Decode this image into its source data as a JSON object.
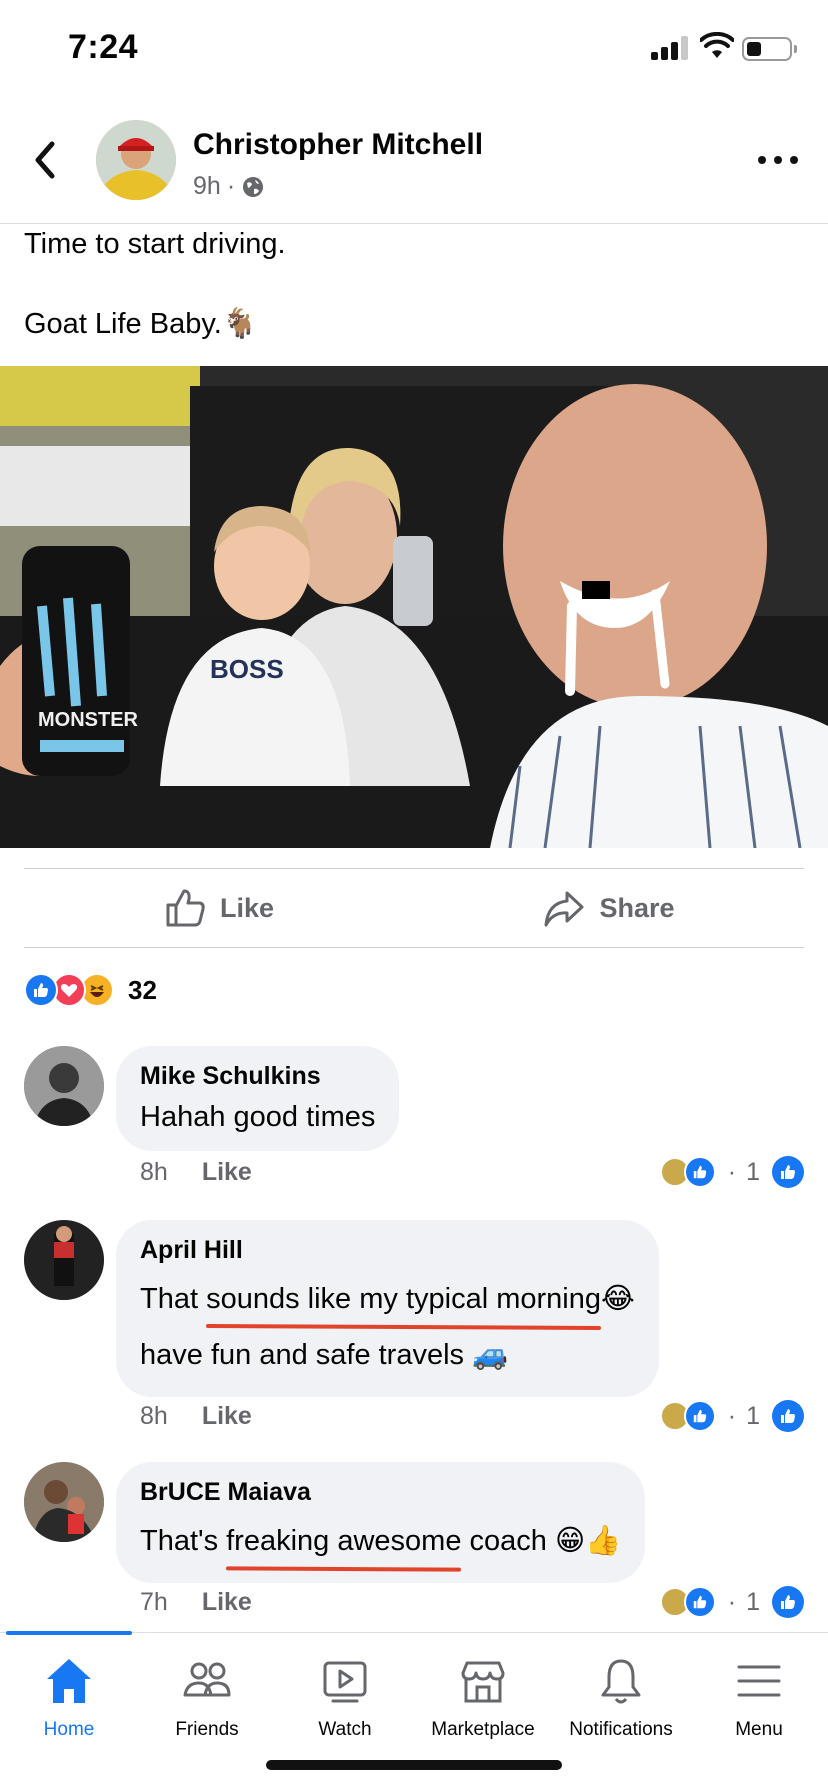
{
  "status_bar": {
    "time": "7:24"
  },
  "post": {
    "author": "Christopher Mitchell",
    "time": "9h",
    "privacy_icon": "globe-icon",
    "lines": [
      "Time to start driving.",
      "Goat Life Baby.🐐"
    ],
    "actions": {
      "like": "Like",
      "share": "Share"
    },
    "reaction_count": "32",
    "reaction_icons": [
      "like",
      "love",
      "haha"
    ]
  },
  "comments": [
    {
      "name": "Mike Schulkins",
      "text": "Hahah good times",
      "time": "8h",
      "like": "Like",
      "reaction_count": "1"
    },
    {
      "name": "April Hill",
      "text_parts": [
        "That ",
        "sounds like my typical morning",
        "😂"
      ],
      "text2": " have fun and safe travels 🚙",
      "time": "8h",
      "like": "Like",
      "reaction_count": "1"
    },
    {
      "name": "BrUCE Maiava",
      "text_parts": [
        "That's ",
        "freaking awesome",
        " coach 😁👍"
      ],
      "time": "7h",
      "like": "Like",
      "reaction_count": "1"
    }
  ],
  "tabs": [
    {
      "label": "Home",
      "active": true
    },
    {
      "label": "Friends"
    },
    {
      "label": "Watch"
    },
    {
      "label": "Marketplace"
    },
    {
      "label": "Notifications"
    },
    {
      "label": "Menu"
    }
  ],
  "colors": {
    "accent": "#1877f2",
    "underline": "#e2432b",
    "bubble": "#f0f2f5",
    "muted": "#65676b"
  }
}
